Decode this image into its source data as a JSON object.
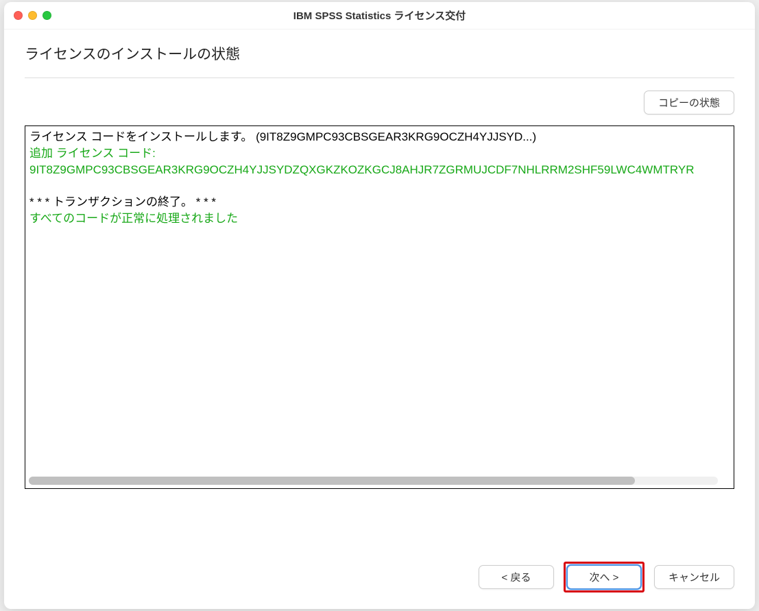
{
  "window": {
    "title": "IBM SPSS Statistics ライセンス交付"
  },
  "heading": "ライセンスのインストールの状態",
  "buttons": {
    "copy_status": "コピーの状態",
    "back": "<  戻る",
    "next": "次へ  >",
    "cancel": "キャンセル"
  },
  "log": {
    "line1": "ライセンス コードをインストールします。 (9IT8Z9GMPC93CBSGEAR3KRG9OCZH4YJJSYD...)",
    "line2": "追加 ライセンス コード:",
    "line3": "9IT8Z9GMPC93CBSGEAR3KRG9OCZH4YJJSYDZQXGKZKOZKGCJ8AHJR7ZGRMUJCDF7NHLRRM2SHF59LWC4WMTRYR",
    "line4": " ",
    "line5": "   * * * トランザクションの終了。 * * *",
    "line6": "すべてのコードが正常に処理されました"
  }
}
